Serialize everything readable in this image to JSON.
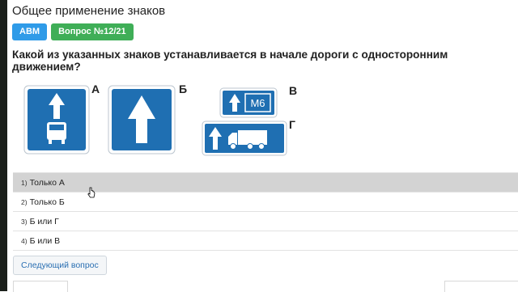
{
  "section_title": "Общее применение знаков",
  "badges": {
    "category": "ABM",
    "question": "Вопрос №12/21"
  },
  "question_text": "Какой из указанных знаков устанавливается в начале дороги с односторонним движением?",
  "signs": {
    "label_a": "А",
    "label_b": "Б",
    "label_v": "В",
    "label_g": "Г",
    "route_text": "М6",
    "color_blue": "#1f6fb2",
    "color_border": "#ffffff"
  },
  "answers": [
    {
      "num": "1)",
      "text": "Только А",
      "selected": true
    },
    {
      "num": "2)",
      "text": "Только Б",
      "selected": false
    },
    {
      "num": "3)",
      "text": "Б или Г",
      "selected": false
    },
    {
      "num": "4)",
      "text": "Б или В",
      "selected": false
    }
  ],
  "next_button": "Следующий вопрос"
}
